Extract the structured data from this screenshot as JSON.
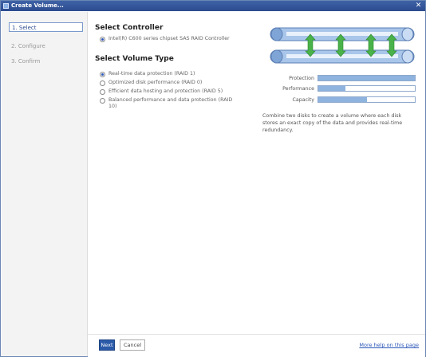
{
  "window": {
    "title": "Create Volume..."
  },
  "steps": [
    {
      "label": "1. Select",
      "active": true
    },
    {
      "label": "2. Configure",
      "active": false
    },
    {
      "label": "3. Confirm",
      "active": false
    }
  ],
  "controller": {
    "heading": "Select Controller",
    "option": "Intel(R) C600 series chipset SAS RAID Controller"
  },
  "volume_type": {
    "heading": "Select Volume Type",
    "options": [
      {
        "label": "Real-time data protection (RAID 1)",
        "checked": true
      },
      {
        "label": "Optimized disk performance (RAID 0)",
        "checked": false
      },
      {
        "label": "Efficient data hosting and protection (RAID 5)",
        "checked": false
      },
      {
        "label": "Balanced performance and data protection (RAID",
        "label2": "10)",
        "checked": false
      }
    ]
  },
  "meters": [
    {
      "label": "Protection",
      "level": 1.0
    },
    {
      "label": "Performance",
      "level": 0.28
    },
    {
      "label": "Capacity",
      "level": 0.5
    }
  ],
  "description": "Combine two disks to create a volume where each disk stores an exact copy of the data and provides real-time redundancy.",
  "footer": {
    "next_label": "Next",
    "cancel_label": "Cancel",
    "help_link": "More help on this page"
  }
}
